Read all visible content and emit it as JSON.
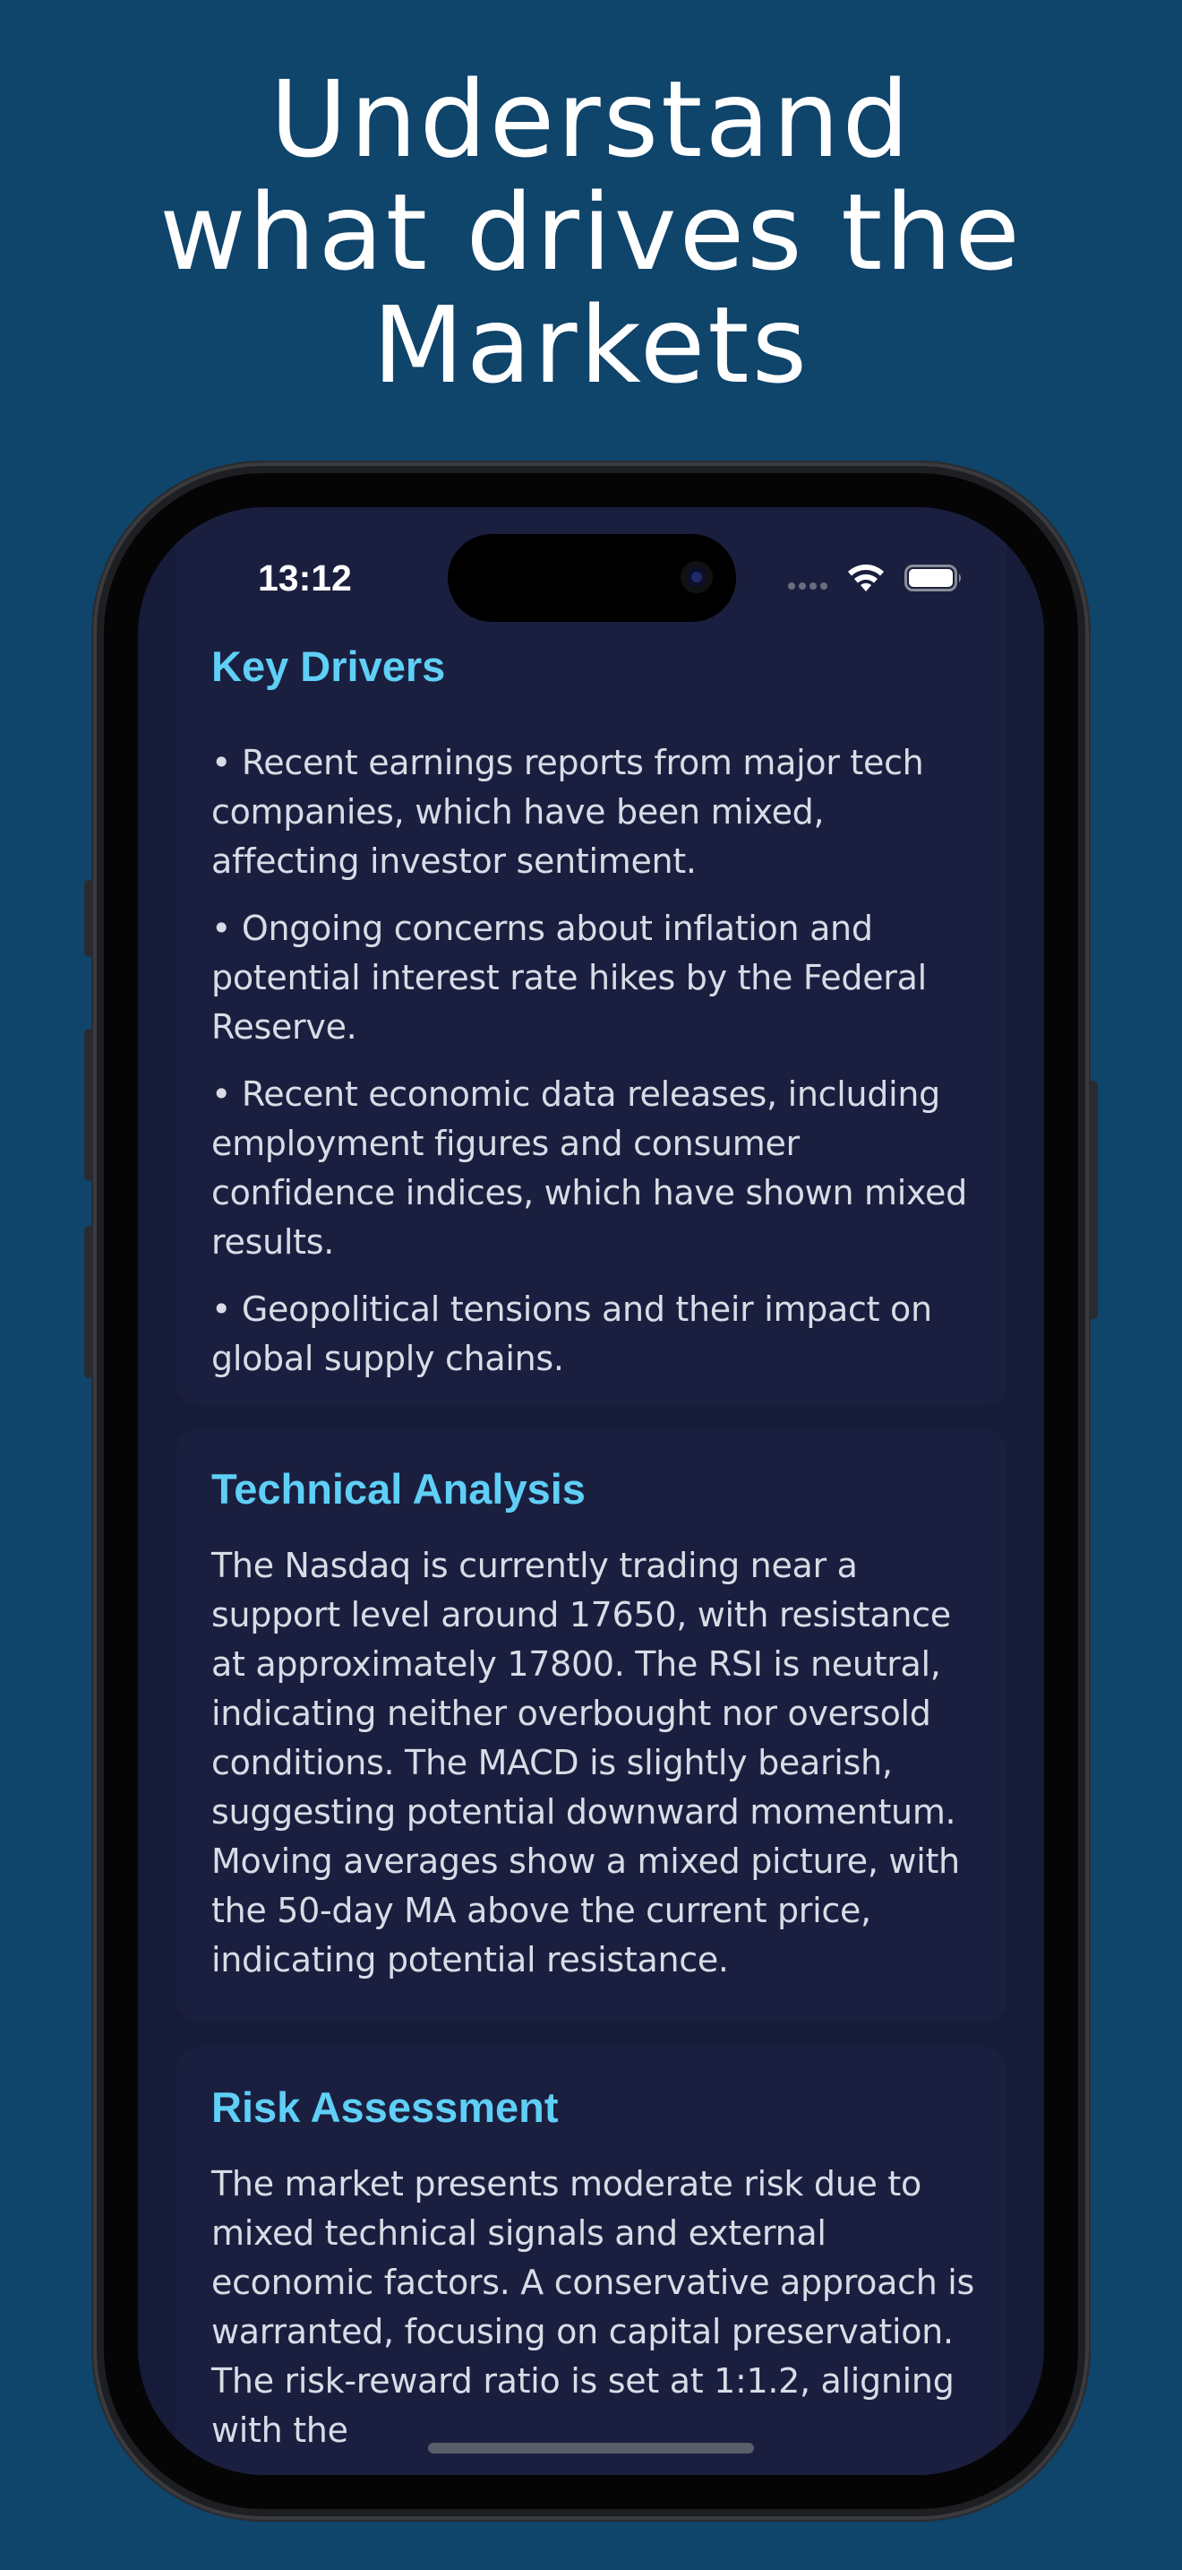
{
  "headline": {
    "line1": "Understand",
    "line2": "what drives the",
    "line3": "Markets"
  },
  "status_bar": {
    "time": "13:12"
  },
  "key_drivers": {
    "title": "Key Drivers",
    "bullets": [
      "• Recent earnings reports from major tech companies, which have been mixed, affecting investor sentiment.",
      "• Ongoing concerns about inflation and potential interest rate hikes by the Federal Reserve.",
      "• Recent economic data releases, including employment figures and consumer confidence indices, which have shown mixed results.",
      "• Geopolitical tensions and their impact on global supply chains."
    ]
  },
  "technical_analysis": {
    "title": "Technical Analysis",
    "body": "The Nasdaq is currently trading near a support level around 17650, with resistance at approximately 17800. The RSI is neutral, indicating neither overbought nor oversold conditions. The MACD is slightly bearish, suggesting potential downward momentum. Moving averages show a mixed picture, with the 50-day MA above the current price, indicating potential resistance."
  },
  "risk_assessment": {
    "title": "Risk Assessment",
    "body": "The market presents moderate risk due to mixed technical signals and external economic factors. A conservative approach is warranted, focusing on capital preservation. The risk-reward ratio is set at 1:1.2, aligning with the"
  },
  "icons": {
    "wifi": "wifi-icon",
    "battery": "battery-icon",
    "signal": "cellular-signal-icon"
  },
  "colors": {
    "background": "#0f446b",
    "screen": "#161b3a",
    "card": "#1b1f3f",
    "accent": "#5fcff6",
    "text": "#d9dce6"
  }
}
